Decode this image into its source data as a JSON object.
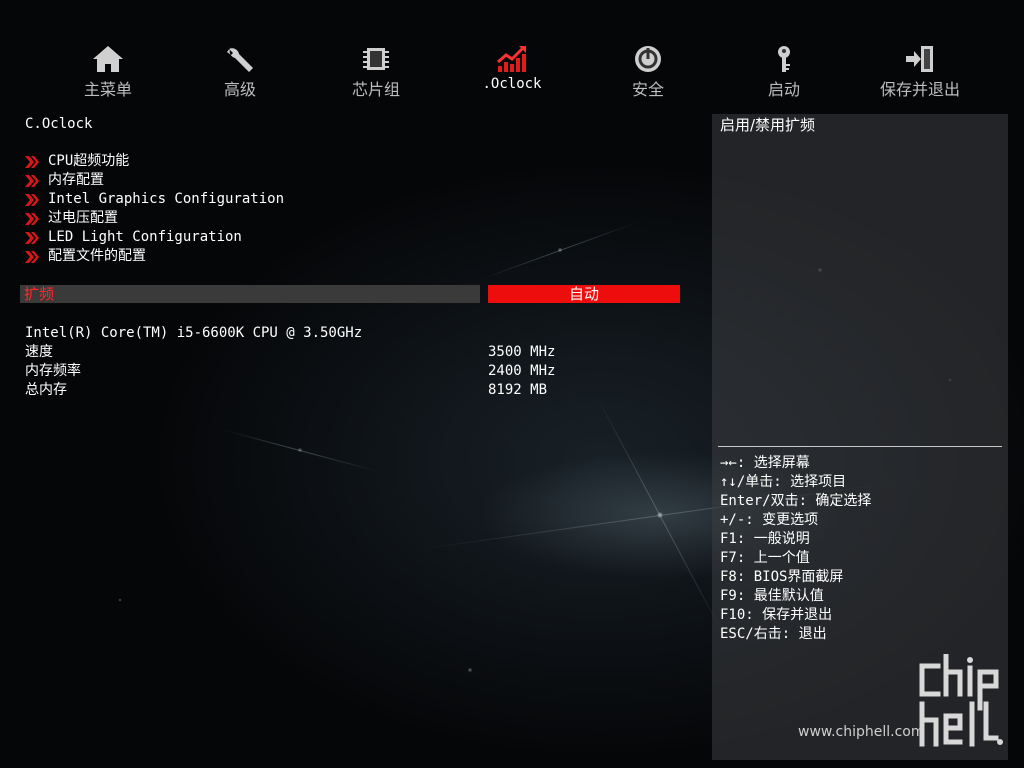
{
  "nav": {
    "items": [
      {
        "label": "主菜单",
        "icon": "home-icon"
      },
      {
        "label": "高级",
        "icon": "wrench-icon"
      },
      {
        "label": "芯片组",
        "icon": "chip-icon"
      },
      {
        "label": ".Oclock",
        "icon": "oc-chart-icon",
        "active": true
      },
      {
        "label": "安全",
        "icon": "power-shield-icon"
      },
      {
        "label": "启动",
        "icon": "key-icon"
      },
      {
        "label": "保存并退出",
        "icon": "exit-icon"
      }
    ]
  },
  "main": {
    "section_title": "C.Oclock",
    "menu": [
      "CPU超频功能",
      "内存配置",
      "Intel Graphics Configuration",
      "过电压配置",
      "LED Light Configuration",
      "配置文件的配置"
    ],
    "option": {
      "label": "扩频",
      "value": "自动"
    },
    "info": {
      "cpu": "Intel(R) Core(TM) i5-6600K CPU @ 3.50GHz",
      "rows": [
        {
          "label": "速度",
          "value": "3500 MHz"
        },
        {
          "label": "内存频率",
          "value": "2400 MHz"
        },
        {
          "label": "总内存",
          "value": "8192 MB"
        }
      ]
    }
  },
  "help": {
    "title": "启用/禁用扩频",
    "keys": [
      "→←: 选择屏幕",
      "↑↓/单击: 选择项目",
      "Enter/双击: 确定选择",
      "+/-: 变更选项",
      "F1: 一般说明",
      "F7: 上一个值",
      "F8: BIOS界面截屏",
      "F9: 最佳默认值",
      "F10: 保存并退出",
      "ESC/右击: 退出"
    ]
  },
  "watermark": {
    "url": "www.chiphell.com"
  },
  "colors": {
    "accent": "#ee0d0d",
    "option_label": "#ff2a2a",
    "panel": "#3c3e42"
  }
}
